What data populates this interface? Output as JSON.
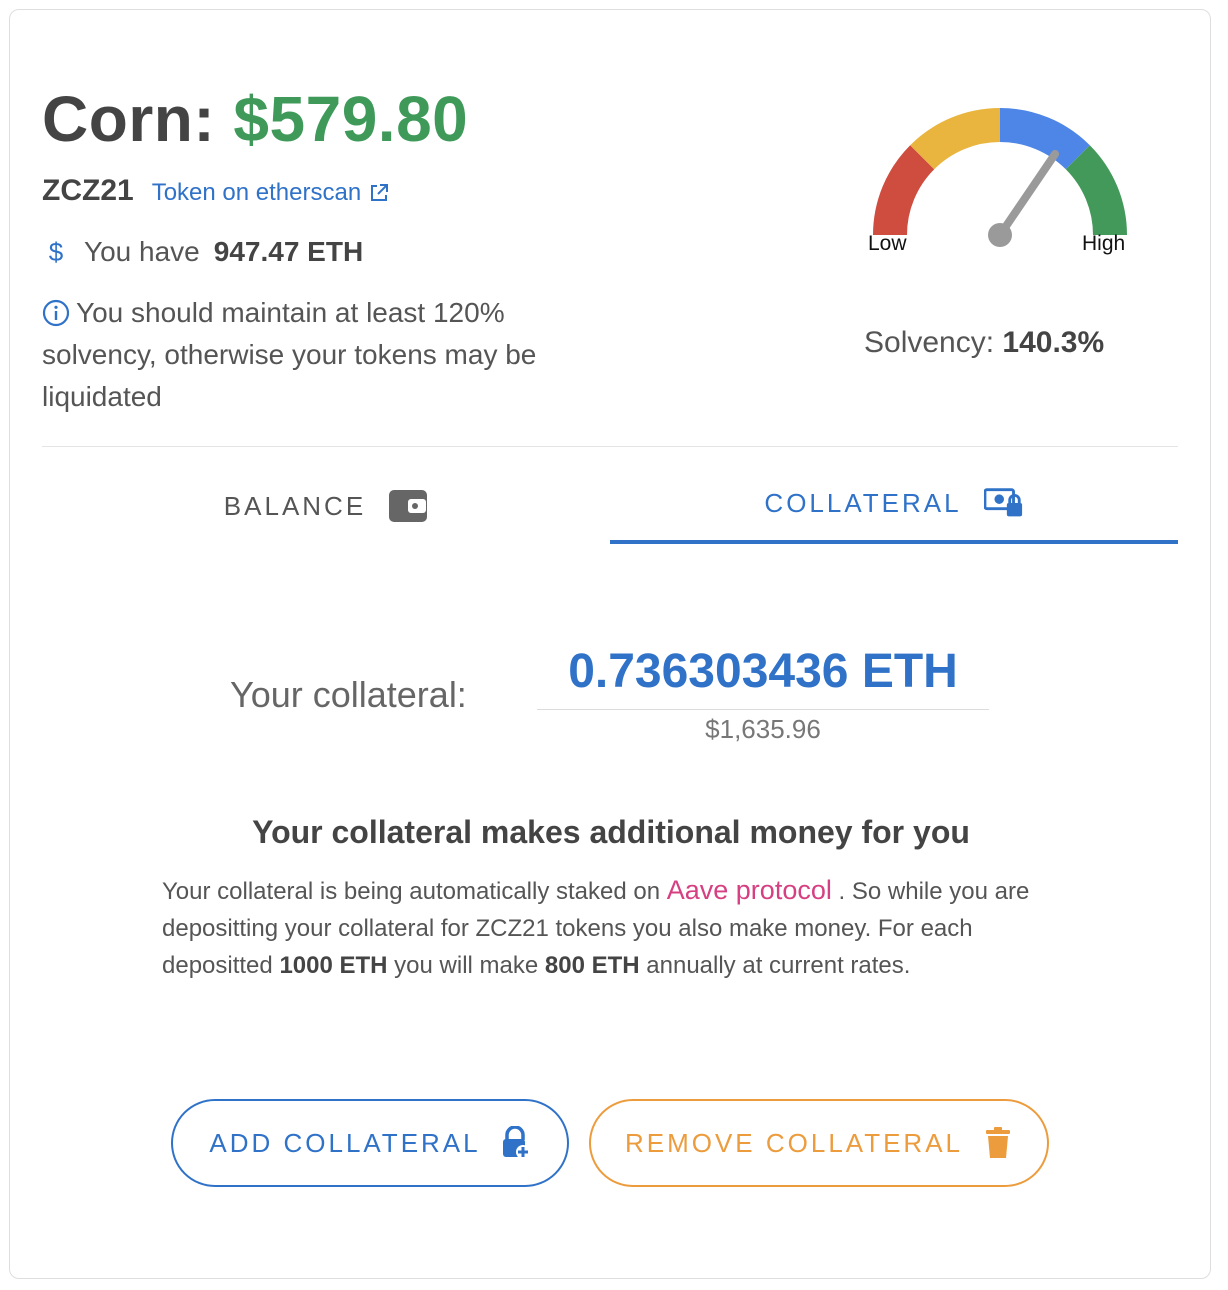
{
  "header": {
    "asset_name": "Corn:",
    "price": "$579.80",
    "ticker": "ZCZ21",
    "etherscan_link": "Token on etherscan",
    "have_prefix": "You have",
    "have_amount": "947.47 ETH",
    "warning_text": "You should maintain at least 120% solvency, otherwise your tokens may be liquidated"
  },
  "gauge": {
    "low_label": "Low",
    "high_label": "High",
    "solvency_label": "Solvency:",
    "solvency_value": "140.3%",
    "needle_fraction": 0.69,
    "colors": [
      "#cf4d3f",
      "#e9b53f",
      "#4d86e6",
      "#43995a"
    ]
  },
  "tabs": [
    {
      "label": "BALANCE",
      "icon": "wallet-icon",
      "active": false
    },
    {
      "label": "COLLATERAL",
      "icon": "locked-cash-icon",
      "active": true
    }
  ],
  "collateral": {
    "label": "Your collateral:",
    "value": "0.736303436 ETH",
    "usd_value": "$1,635.96"
  },
  "info": {
    "title": "Your collateral makes additional money for you",
    "text_1": "Your collateral is being automatically staked on",
    "aave_link": "Aave protocol",
    "text_2": ". So while you are depositting your collateral for ZCZ21 tokens you also make money. For each depositted",
    "amount_1": "1000 ETH",
    "text_3": "you will make",
    "amount_2": "800 ETH",
    "text_4": "annually at current rates."
  },
  "buttons": {
    "add_label": "ADD COLLATERAL",
    "remove_label": "REMOVE COLLATERAL"
  },
  "colors": {
    "primary": "#2f72c8",
    "price_green": "#3f9a5a",
    "remove_orange": "#ec9c3d",
    "aave_pink": "#d63f82"
  }
}
